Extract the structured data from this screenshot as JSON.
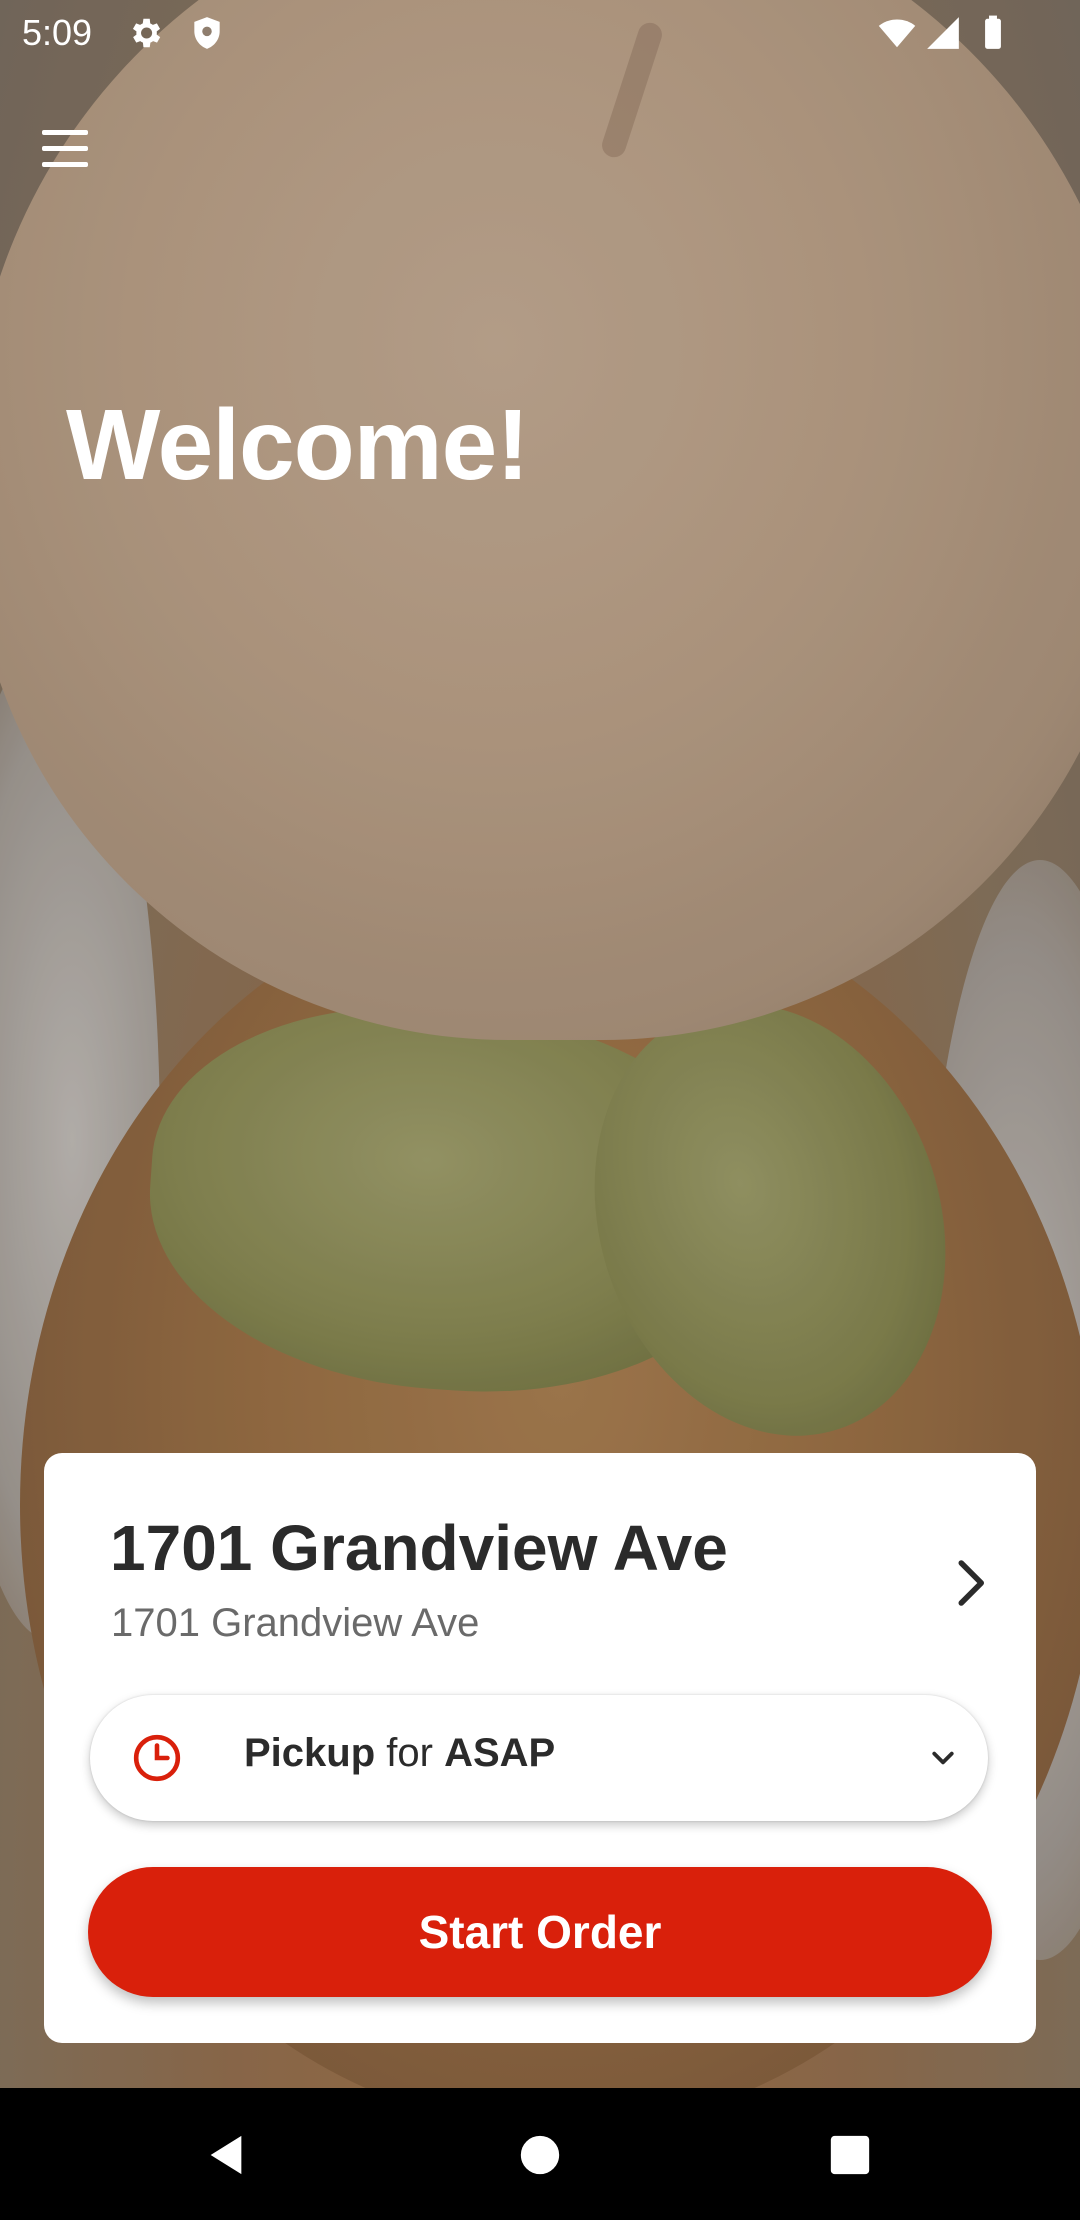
{
  "status_bar": {
    "time": "5:09",
    "icons": [
      "gear-icon",
      "shield-icon",
      "wifi-icon",
      "cellular-signal-icon",
      "battery-icon"
    ]
  },
  "header": {
    "menu_icon": "hamburger-menu-icon"
  },
  "hero": {
    "welcome_text": "Welcome!"
  },
  "location_card": {
    "title": "1701 Grandview Ave",
    "subtitle": "1701 Grandview Ave",
    "chevron_icon": "chevron-right-icon"
  },
  "pickup_selector": {
    "mode": "Pickup",
    "connector": "for",
    "time": "ASAP",
    "icon": "clock-icon",
    "dropdown_icon": "chevron-down-icon"
  },
  "start_order": {
    "label": "Start Order"
  },
  "colors": {
    "accent_red": "#d9200b",
    "card_background": "#ffffff",
    "title_text": "#2b2b2b",
    "subtitle_text": "#6a6a6a"
  },
  "nav_bar": {
    "icons": [
      "back-icon",
      "home-icon",
      "recents-icon"
    ]
  }
}
